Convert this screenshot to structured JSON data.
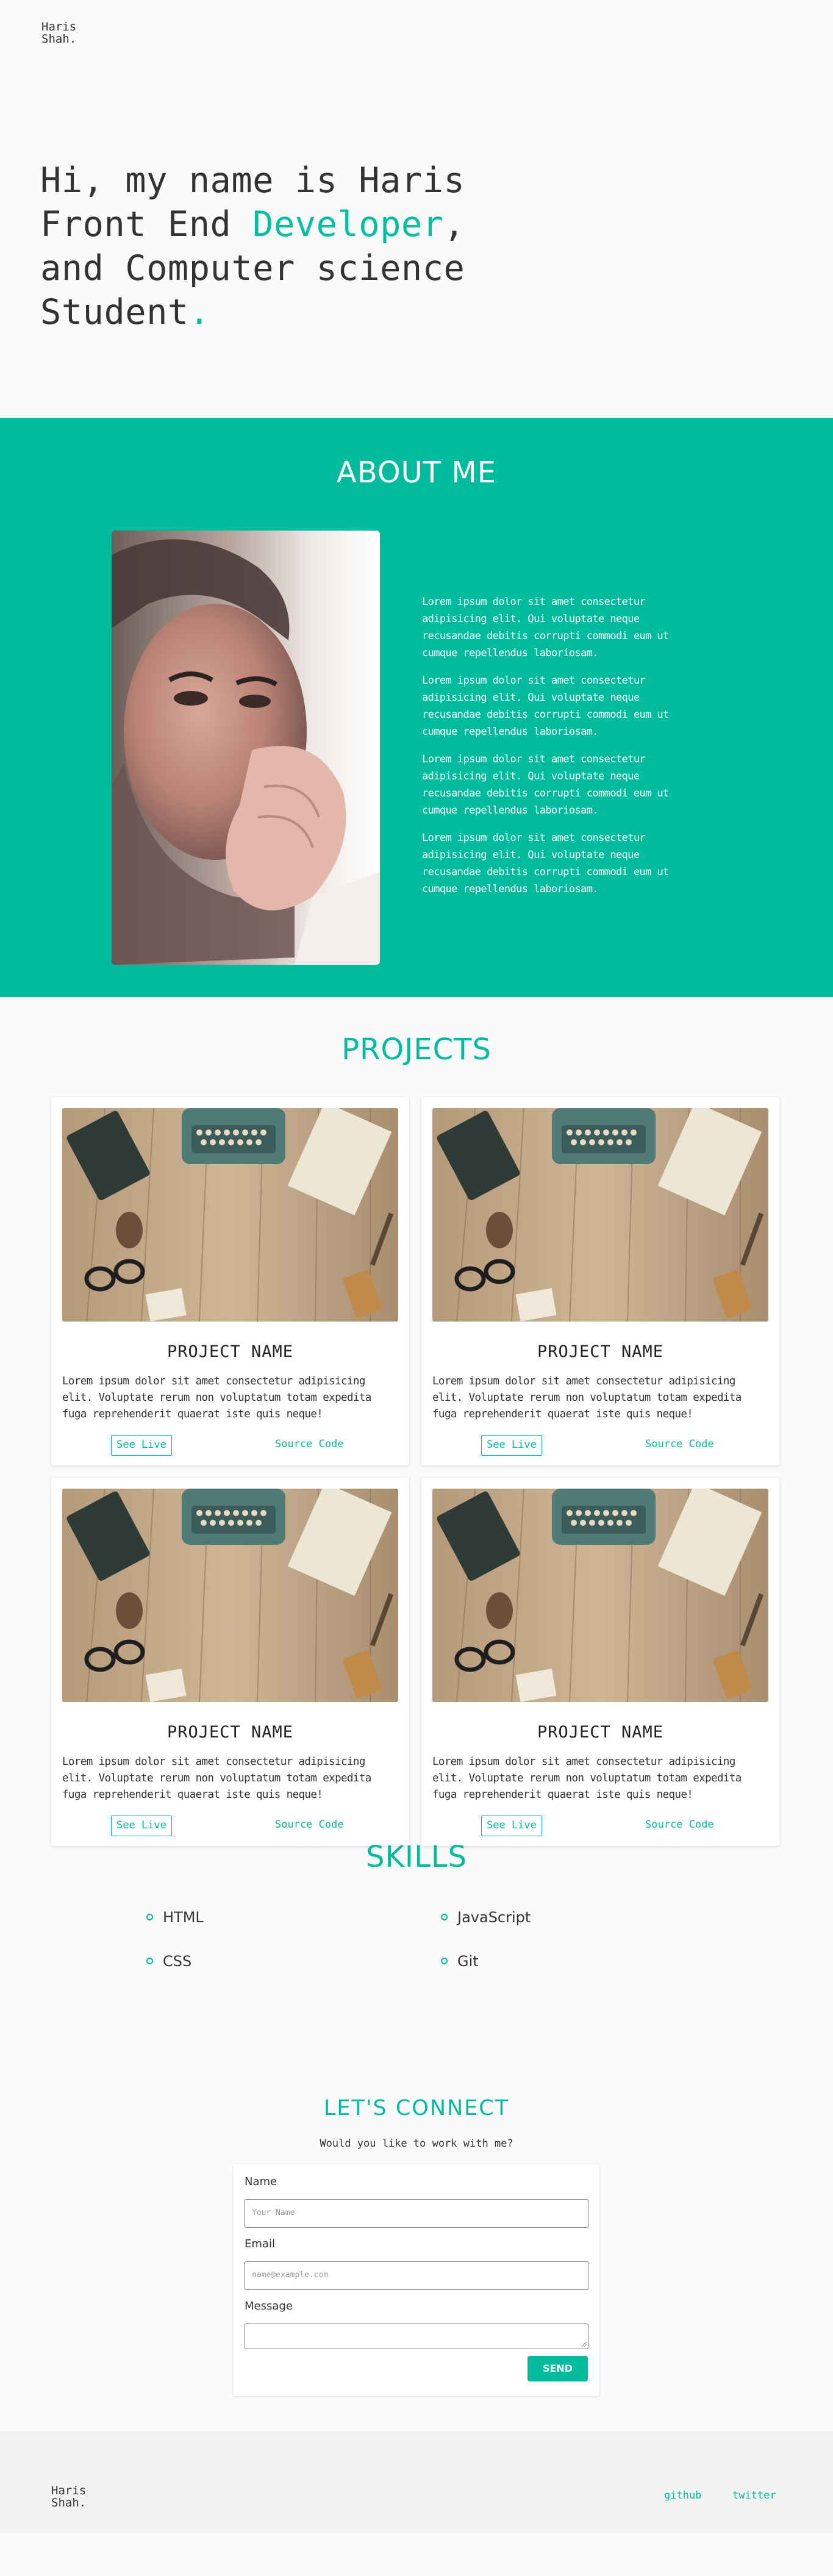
{
  "header": {
    "logo_line1": "Haris",
    "logo_line2": "Shah",
    "logo_dot": "."
  },
  "hero": {
    "line1": "Hi, my name is Haris",
    "line2_pre": "Front End ",
    "line2_accent": "Developer",
    "line2_post": ",",
    "line3": "and Computer science",
    "line4_pre": "Student",
    "line4_accent": "."
  },
  "about": {
    "title": "ABOUT ME",
    "paragraphs": [
      "Lorem ipsum dolor sit amet consectetur adipisicing elit. Qui voluptate neque recusandae debitis corrupti commodi eum ut cumque repellendus laboriosam.",
      "Lorem ipsum dolor sit amet consectetur adipisicing elit. Qui voluptate neque recusandae debitis corrupti commodi eum ut cumque repellendus laboriosam.",
      "Lorem ipsum dolor sit amet consectetur adipisicing elit. Qui voluptate neque recusandae debitis corrupti commodi eum ut cumque repellendus laboriosam.",
      "Lorem ipsum dolor sit amet consectetur adipisicing elit. Qui voluptate neque recusandae debitis corrupti commodi eum ut cumque repellendus laboriosam."
    ]
  },
  "projects": {
    "title": "PROJECTS",
    "items": [
      {
        "name": "PROJECT NAME",
        "description": "Lorem ipsum dolor sit amet consectetur adipisicing elit. Voluptate rerum non voluptatum totam expedita fuga reprehenderit quaerat iste quis neque!",
        "live_label": "See Live",
        "code_label": "Source Code"
      },
      {
        "name": "PROJECT NAME",
        "description": "Lorem ipsum dolor sit amet consectetur adipisicing elit. Voluptate rerum non voluptatum totam expedita fuga reprehenderit quaerat iste quis neque!",
        "live_label": "See Live",
        "code_label": "Source Code"
      },
      {
        "name": "PROJECT NAME",
        "description": "Lorem ipsum dolor sit amet consectetur adipisicing elit. Voluptate rerum non voluptatum totam expedita fuga reprehenderit quaerat iste quis neque!",
        "live_label": "See Live",
        "code_label": "Source Code"
      },
      {
        "name": "PROJECT NAME",
        "description": "Lorem ipsum dolor sit amet consectetur adipisicing elit. Voluptate rerum non voluptatum totam expedita fuga reprehenderit quaerat iste quis neque!",
        "live_label": "See Live",
        "code_label": "Source Code"
      }
    ]
  },
  "skills": {
    "title": "SKILLS",
    "items": [
      "HTML",
      "JavaScript",
      "CSS",
      "Git"
    ]
  },
  "contact": {
    "title": "LET'S CONNECT",
    "subtitle": "Would you like to work with me?",
    "name_label": "Name",
    "name_placeholder": "Your Name",
    "email_label": "Email",
    "email_placeholder": "name@example.com",
    "message_label": "Message",
    "send_label": "SEND"
  },
  "footer": {
    "logo_line1": "Haris",
    "logo_line2": "Shah",
    "logo_dot": ".",
    "github_label": "github",
    "twitter_label": "twitter"
  },
  "colors": {
    "accent": "#00bb9e",
    "text": "#333333",
    "background": "#fafafa"
  }
}
